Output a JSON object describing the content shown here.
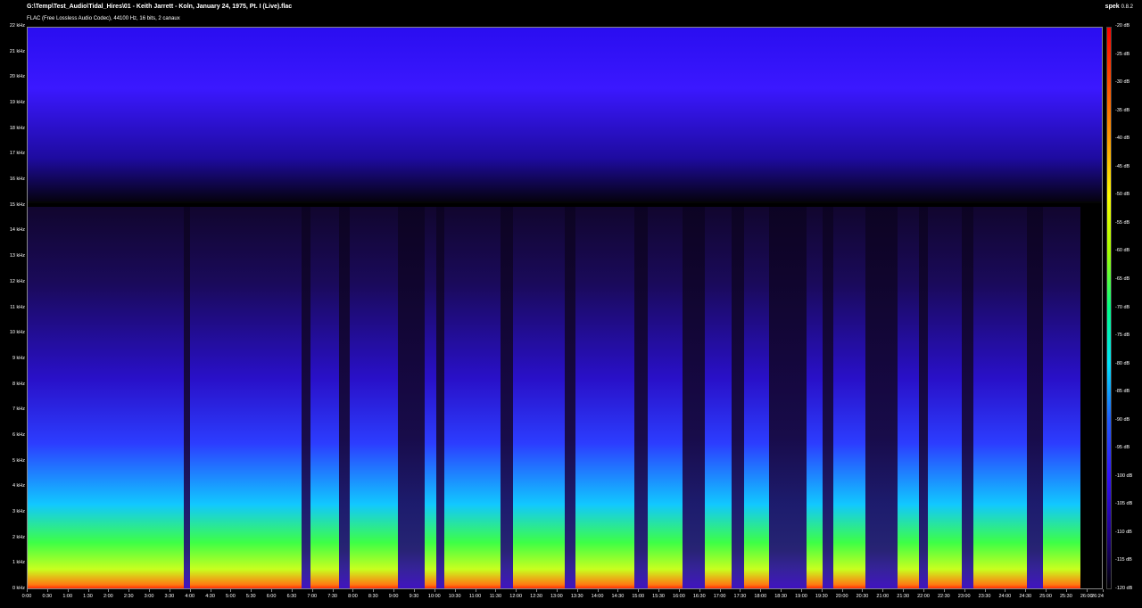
{
  "header": {
    "file_path": "G:\\Temp\\Test_Audio\\Tidal_Hires\\01 - Keith Jarrett - Koln, January 24, 1975, Pt. I (Live).flac",
    "stream_info": "FLAC (Free Lossless Audio Codec), 44100 Hz, 16 bits, 2 canaux",
    "app_name": "spek",
    "app_version": "0.8.2"
  },
  "y_axis_labels": [
    "22 kHz",
    "21 kHz",
    "20 kHz",
    "19 kHz",
    "18 kHz",
    "17 kHz",
    "16 kHz",
    "15 kHz",
    "14 kHz",
    "13 kHz",
    "12 kHz",
    "11 kHz",
    "10 kHz",
    "9 kHz",
    "8 kHz",
    "7 kHz",
    "6 kHz",
    "5 kHz",
    "4 kHz",
    "3 kHz",
    "2 kHz",
    "1 kHz",
    "0 kHz"
  ],
  "x_axis_labels": [
    "0:00",
    "0:30",
    "1:00",
    "1:30",
    "2:00",
    "2:30",
    "3:00",
    "3:30",
    "4:00",
    "4:30",
    "5:00",
    "5:30",
    "6:00",
    "6:30",
    "7:00",
    "7:30",
    "8:00",
    "8:30",
    "9:00",
    "9:30",
    "10:00",
    "10:30",
    "11:00",
    "11:30",
    "12:00",
    "12:30",
    "13:00",
    "13:30",
    "14:00",
    "14:30",
    "15:00",
    "15:30",
    "16:00",
    "16:30",
    "17:00",
    "17:30",
    "18:00",
    "18:30",
    "19:00",
    "19:30",
    "20:00",
    "20:30",
    "21:00",
    "21:30",
    "22:00",
    "22:30",
    "23:00",
    "23:30",
    "24:00",
    "24:30",
    "25:00",
    "25:30",
    "26:00",
    "26:24"
  ],
  "db_labels": [
    "-20 dB",
    "-25 dB",
    "-30 dB",
    "-35 dB",
    "-40 dB",
    "-45 dB",
    "-50 dB",
    "-55 dB",
    "-60 dB",
    "-65 dB",
    "-70 dB",
    "-75 dB",
    "-80 dB",
    "-85 dB",
    "-90 dB",
    "-95 dB",
    "-100 dB",
    "-105 dB",
    "-110 dB",
    "-115 dB",
    "-120 dB"
  ],
  "colors": {
    "background": "#000000",
    "spectrogram_high": "#3b18ff",
    "spectrogram_low": "#ff2f05"
  }
}
